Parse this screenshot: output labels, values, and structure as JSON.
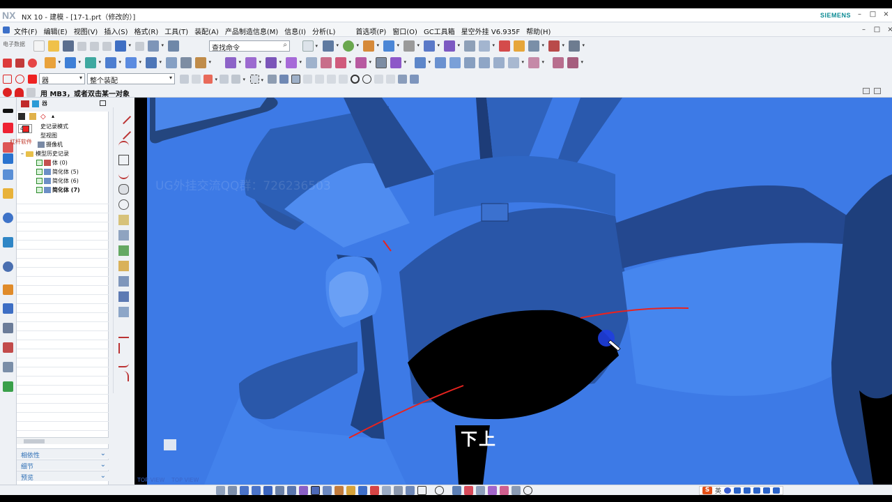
{
  "window": {
    "logo": "NX",
    "title": "NX 10 - 建模 - [17-1.prt（修改的）]",
    "brand": "SIEMENS",
    "controls": [
      "–",
      "□",
      "×"
    ]
  },
  "menubar": {
    "items": [
      "文件(F)",
      "编辑(E)",
      "视图(V)",
      "插入(S)",
      "格式(R)",
      "工具(T)",
      "装配(A)",
      "产品制造信息(M)",
      "信息(I)",
      "分析(L)"
    ],
    "extras": [
      "首选项(P)",
      "窗口(O)",
      "GC工具箱",
      "星空外挂 V6.935F",
      "帮助(H)"
    ],
    "controls": [
      "–",
      "□",
      "×"
    ]
  },
  "toolbar": {
    "label": "电子数据",
    "search_placeholder": "查找命令",
    "filter_combo": "器",
    "assembly_combo": "整个装配"
  },
  "cue_line": {
    "text": "用 MB3，或者双击某一对象"
  },
  "navigator": {
    "combo_value": "4",
    "tab_label": "杠杆软件",
    "rows": [
      {
        "label": "史记录模式",
        "indent": 0
      },
      {
        "label": "型视图",
        "indent": 0
      },
      {
        "label": "摄像机",
        "indent": 0
      },
      {
        "label": "模型历史记录",
        "indent": 1,
        "folder": true
      },
      {
        "label": "体 (0)",
        "indent": 2,
        "suffix": "L"
      },
      {
        "label": "简化体 (5)",
        "indent": 2,
        "suffix": "S"
      },
      {
        "label": "简化体 (6)",
        "indent": 2,
        "suffix": "S"
      },
      {
        "label": "简化体 (7)",
        "indent": 2,
        "suffix": "S",
        "bold": true
      }
    ],
    "panels": [
      "相依性",
      "细节",
      "预览"
    ]
  },
  "viewport": {
    "view_labels": [
      "TOP VIEW",
      "TOP VIEW"
    ],
    "watermark": "UG外挂交流QQ群：726236503",
    "subtitle": "下上",
    "model_color": "#3a78e6",
    "annotation_color": "#e8231f"
  },
  "ime": {
    "logo": "S",
    "mode": "英"
  }
}
